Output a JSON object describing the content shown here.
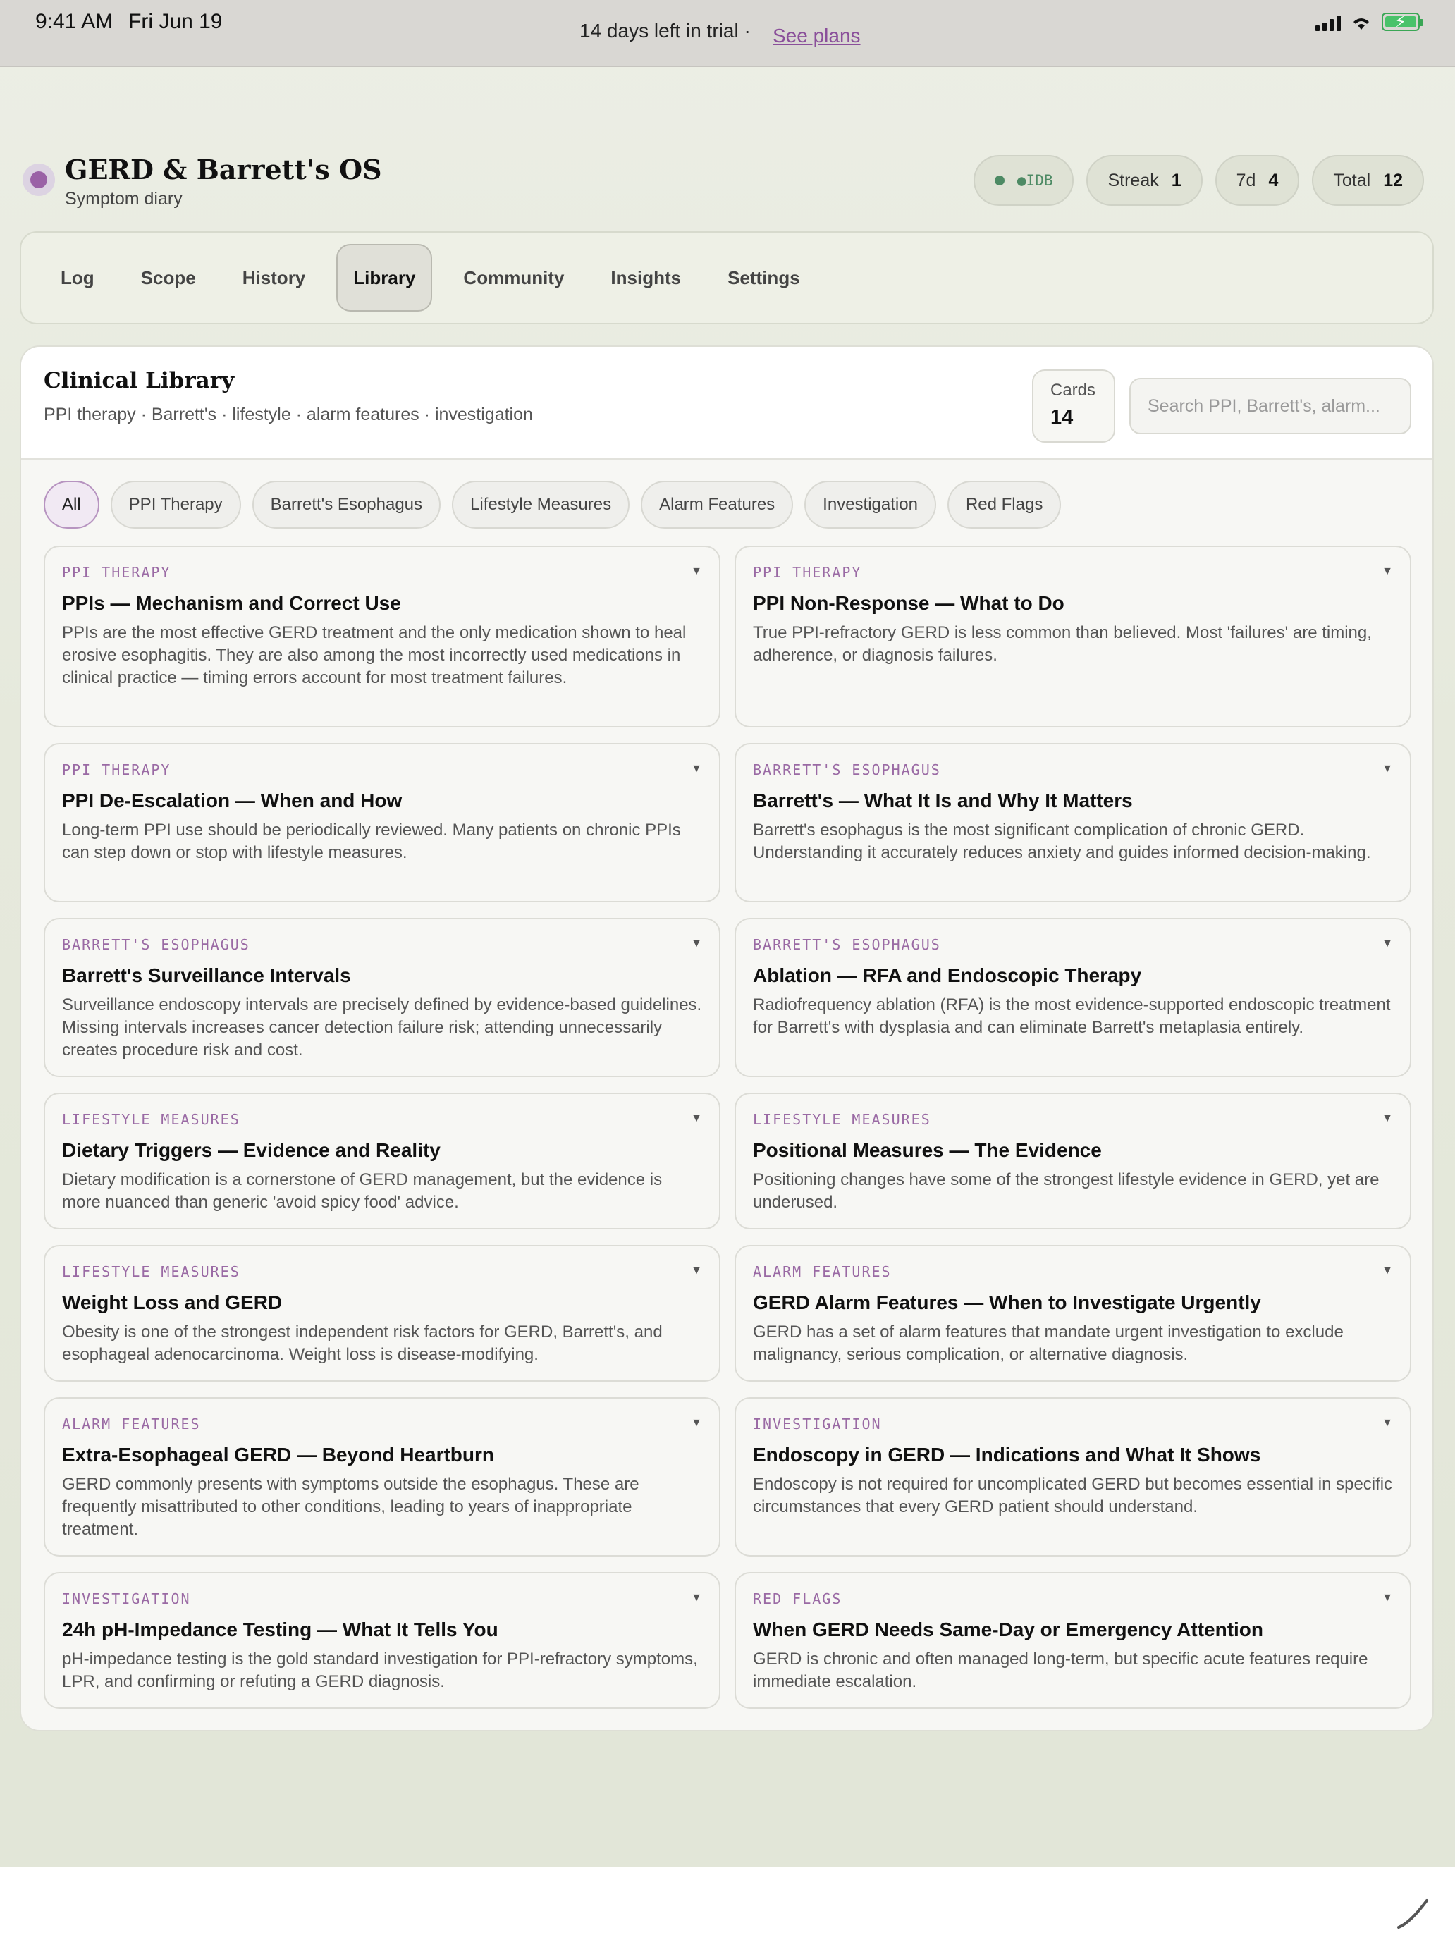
{
  "status_bar": {
    "time": "9:41 AM",
    "date": "Fri Jun 19",
    "trial_text": "14 days left in trial ·",
    "plans_link": "See plans"
  },
  "header": {
    "title": "GERD & Barrett's OS",
    "subtitle": "Symptom diary",
    "idb_label": "●IDB",
    "streak_label": "Streak",
    "streak_value": "1",
    "week_label": "7d",
    "week_value": "4",
    "total_label": "Total",
    "total_value": "12"
  },
  "nav": {
    "tabs": [
      {
        "label": "Log"
      },
      {
        "label": "Scope"
      },
      {
        "label": "History"
      },
      {
        "label": "Library"
      },
      {
        "label": "Community"
      },
      {
        "label": "Insights"
      },
      {
        "label": "Settings"
      }
    ],
    "active": "Library"
  },
  "library": {
    "title": "Clinical Library",
    "subtitle": "PPI therapy · Barrett's · lifestyle · alarm features · investigation",
    "cards_label": "Cards",
    "cards_count": "14",
    "search_placeholder": "Search PPI, Barrett's, alarm...",
    "filters": [
      {
        "label": "All"
      },
      {
        "label": "PPI Therapy"
      },
      {
        "label": "Barrett's Esophagus"
      },
      {
        "label": "Lifestyle Measures"
      },
      {
        "label": "Alarm Features"
      },
      {
        "label": "Investigation"
      },
      {
        "label": "Red Flags"
      }
    ],
    "cards": [
      {
        "category": "PPI Therapy",
        "title": "PPIs — Mechanism and Correct Use",
        "desc": "PPIs are the most effective GERD treatment and the only medication shown to heal erosive esophagitis. They are also among the most incorrectly used medications in clinical practice — timing errors account for most treatment failures."
      },
      {
        "category": "PPI Therapy",
        "title": "PPI Non-Response — What to Do",
        "desc": "True PPI-refractory GERD is less common than believed. Most 'failures' are timing, adherence, or diagnosis failures."
      },
      {
        "category": "PPI Therapy",
        "title": "PPI De-Escalation — When and How",
        "desc": "Long-term PPI use should be periodically reviewed. Many patients on chronic PPIs can step down or stop with lifestyle measures."
      },
      {
        "category": "Barrett's Esophagus",
        "title": "Barrett's — What It Is and Why It Matters",
        "desc": "Barrett's esophagus is the most significant complication of chronic GERD. Understanding it accurately reduces anxiety and guides informed decision-making."
      },
      {
        "category": "Barrett's Esophagus",
        "title": "Barrett's Surveillance Intervals",
        "desc": "Surveillance endoscopy intervals are precisely defined by evidence-based guidelines. Missing intervals increases cancer detection failure risk; attending unnecessarily creates procedure risk and cost."
      },
      {
        "category": "Barrett's Esophagus",
        "title": "Ablation — RFA and Endoscopic Therapy",
        "desc": "Radiofrequency ablation (RFA) is the most evidence-supported endoscopic treatment for Barrett's with dysplasia and can eliminate Barrett's metaplasia entirely."
      },
      {
        "category": "Lifestyle Measures",
        "title": "Dietary Triggers — Evidence and Reality",
        "desc": "Dietary modification is a cornerstone of GERD management, but the evidence is more nuanced than generic 'avoid spicy food' advice."
      },
      {
        "category": "Lifestyle Measures",
        "title": "Positional Measures — The Evidence",
        "desc": "Positioning changes have some of the strongest lifestyle evidence in GERD, yet are underused."
      },
      {
        "category": "Lifestyle Measures",
        "title": "Weight Loss and GERD",
        "desc": "Obesity is one of the strongest independent risk factors for GERD, Barrett's, and esophageal adenocarcinoma. Weight loss is disease-modifying."
      },
      {
        "category": "Alarm Features",
        "title": "GERD Alarm Features — When to Investigate Urgently",
        "desc": "GERD has a set of alarm features that mandate urgent investigation to exclude malignancy, serious complication, or alternative diagnosis."
      },
      {
        "category": "Alarm Features",
        "title": "Extra-Esophageal GERD — Beyond Heartburn",
        "desc": "GERD commonly presents with symptoms outside the esophagus. These are frequently misattributed to other conditions, leading to years of inappropriate treatment."
      },
      {
        "category": "Investigation",
        "title": "Endoscopy in GERD — Indications and What It Shows",
        "desc": "Endoscopy is not required for uncomplicated GERD but becomes essential in specific circumstances that every GERD patient should understand."
      },
      {
        "category": "Investigation",
        "title": "24h pH-Impedance Testing — What It Tells You",
        "desc": "pH-impedance testing is the gold standard investigation for PPI-refractory symptoms, LPR, and confirming or refuting a GERD diagnosis."
      },
      {
        "category": "Red Flags",
        "title": "When GERD Needs Same-Day or Emergency Attention",
        "desc": "GERD is chronic and often managed long-term, but specific acute features require immediate escalation."
      }
    ]
  },
  "icons": {
    "battery": "battery-charging-icon",
    "wifi": "wifi-icon",
    "signal": "signal-icon",
    "caret": "caret-down-icon",
    "pencil": "pencil-icon"
  },
  "colors": {
    "accent": "#9a62a6",
    "status_green": "#4d8a64"
  }
}
